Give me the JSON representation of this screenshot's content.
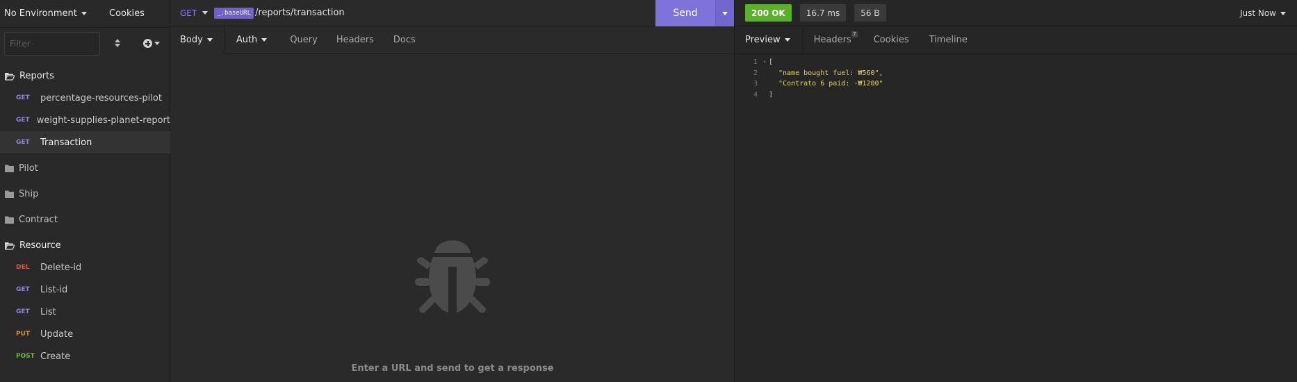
{
  "sidebar": {
    "environment_label": "No Environment",
    "cookies_label": "Cookies",
    "filter_placeholder": "Filter",
    "folders": [
      {
        "name": "Reports",
        "open": true,
        "requests": [
          {
            "method": "GET",
            "name": "percentage-resources-pilot"
          },
          {
            "method": "GET",
            "name": "weight-supplies-planet-report"
          },
          {
            "method": "GET",
            "name": "Transaction",
            "active": true
          }
        ]
      },
      {
        "name": "Pilot",
        "open": false,
        "requests": []
      },
      {
        "name": "Ship",
        "open": false,
        "requests": []
      },
      {
        "name": "Contract",
        "open": false,
        "requests": []
      },
      {
        "name": "Resource",
        "open": true,
        "requests": [
          {
            "method": "DEL",
            "name": "Delete-id"
          },
          {
            "method": "GET",
            "name": "List-id"
          },
          {
            "method": "GET",
            "name": "List"
          },
          {
            "method": "PUT",
            "name": "Update"
          },
          {
            "method": "POST",
            "name": "Create"
          }
        ]
      }
    ]
  },
  "method_colors": {
    "GET": "#8f82e8",
    "DEL": "#e0544a",
    "PUT": "#e58a2c",
    "POST": "#6dbb3a"
  },
  "request": {
    "method": "GET",
    "url_variable": "_.baseURL",
    "url_path": "/reports/transaction",
    "send_label": "Send",
    "tabs": {
      "body": "Body",
      "auth": "Auth",
      "query": "Query",
      "headers": "Headers",
      "docs": "Docs"
    },
    "empty_message": "Enter a URL and send to get a response",
    "empty_icon": "bug-icon"
  },
  "response": {
    "status": "200 OK",
    "time": "16.7 ms",
    "size": "56 B",
    "timestamp_label": "Just Now",
    "tabs": {
      "preview": "Preview",
      "headers": "Headers",
      "headers_count": "7",
      "cookies": "Cookies",
      "timeline": "Timeline"
    },
    "body_lines": [
      {
        "n": "1",
        "text": "[",
        "kind": "brace",
        "fold": true
      },
      {
        "n": "2",
        "text": "\"name bought fuel: ₩560\"",
        "kind": "str",
        "comma": true
      },
      {
        "n": "3",
        "text": "\"Contrato 6 paid: -₩1200\"",
        "kind": "str"
      },
      {
        "n": "4",
        "text": "]",
        "kind": "brace"
      }
    ]
  }
}
